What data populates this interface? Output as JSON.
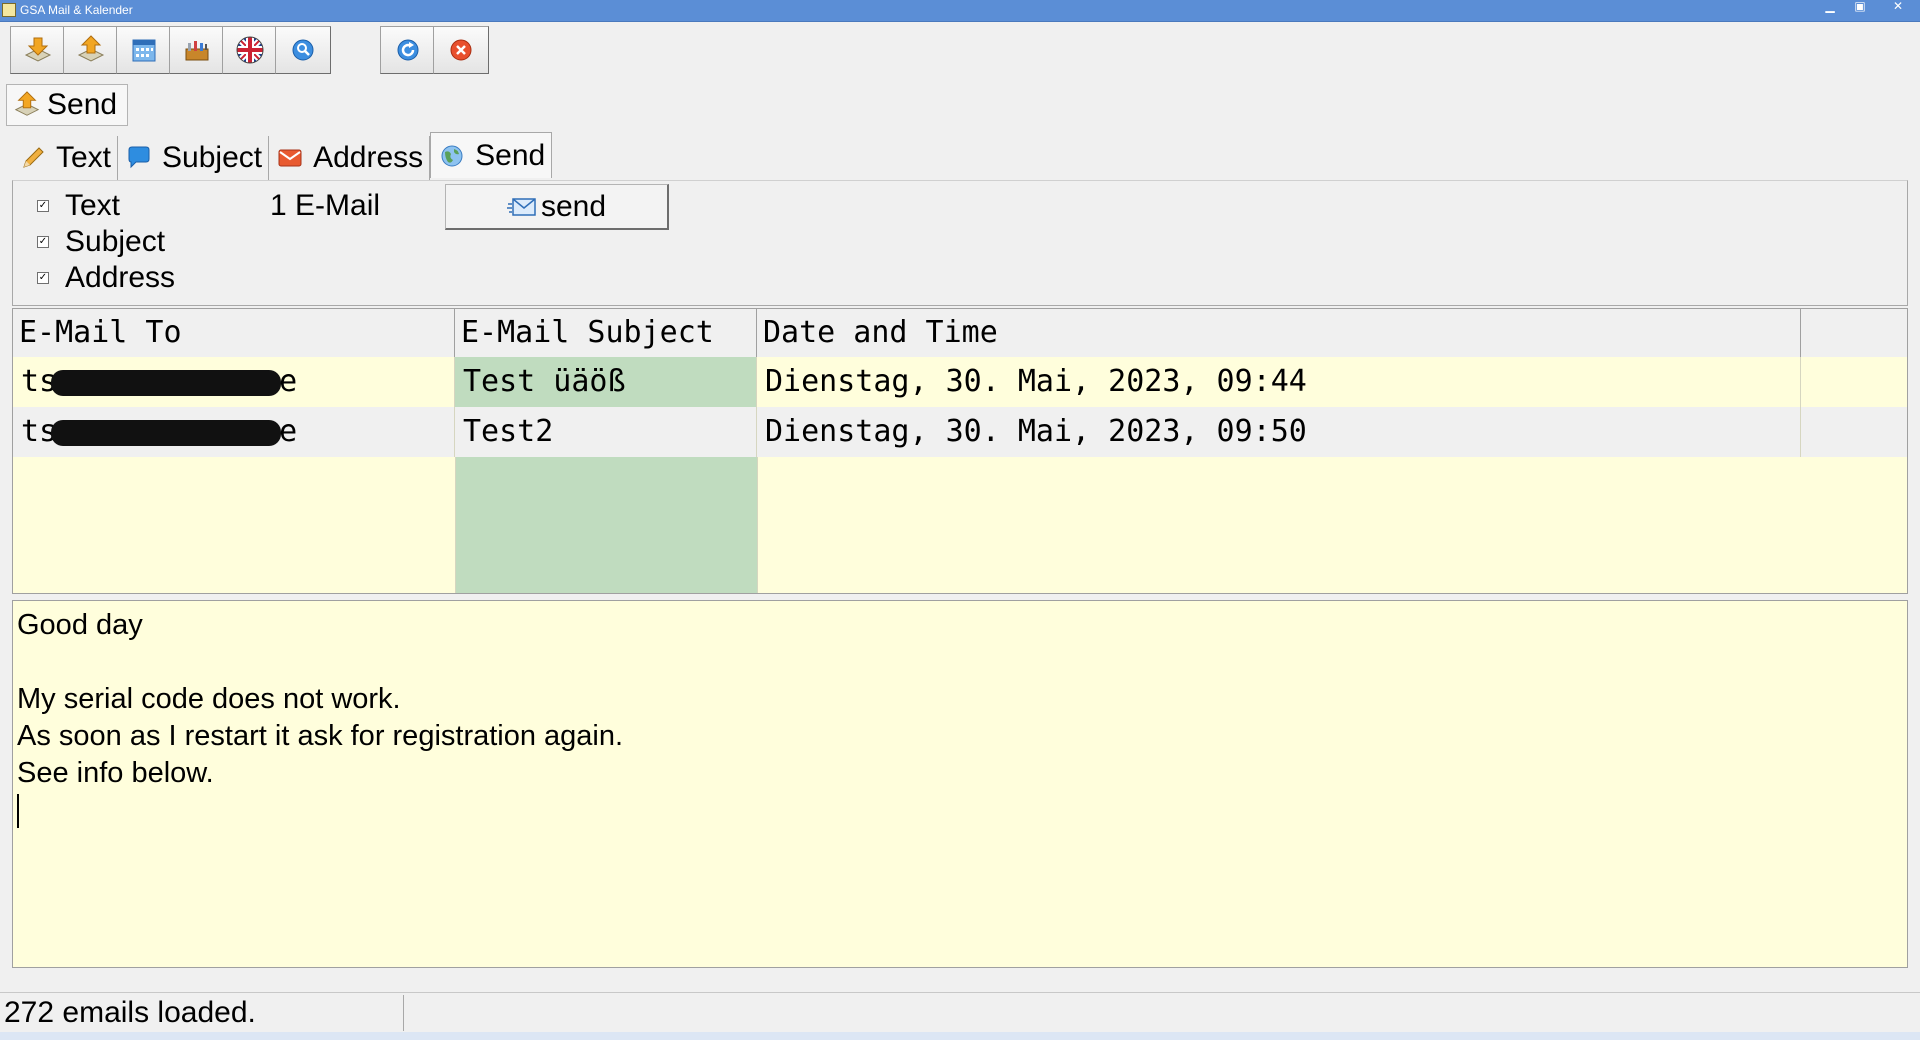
{
  "window": {
    "title": "GSA Mail & Kalender"
  },
  "toolbar": {
    "buttons": [
      {
        "icon": "download-icon"
      },
      {
        "icon": "upload-icon"
      },
      {
        "icon": "calendar-icon"
      },
      {
        "icon": "toolbox-icon"
      },
      {
        "icon": "uk-flag-icon"
      },
      {
        "icon": "search-icon"
      },
      {
        "icon": "refresh-icon"
      },
      {
        "icon": "close-icon"
      }
    ]
  },
  "header": {
    "send_label": "Send"
  },
  "tabs": [
    {
      "label": "Text",
      "icon": "pencil-icon"
    },
    {
      "label": "Subject",
      "icon": "speech-bubble-icon"
    },
    {
      "label": "Address",
      "icon": "envelope-icon"
    },
    {
      "label": "Send",
      "icon": "globe-icon",
      "active": true
    }
  ],
  "options": {
    "checkboxes": [
      {
        "label": "Text",
        "checked": true
      },
      {
        "label": "Subject",
        "checked": true
      },
      {
        "label": "Address",
        "checked": true
      }
    ],
    "count_label": "1 E-Mail",
    "send_button": "send"
  },
  "grid": {
    "columns": [
      "E-Mail To",
      "E-Mail Subject",
      "Date and Time"
    ],
    "rows": [
      {
        "to_prefix": "ts",
        "to_suffix": "e",
        "subject": "Test üäöß",
        "datetime": "Dienstag, 30. Mai, 2023, 09:44"
      },
      {
        "to_prefix": "ts",
        "to_suffix": "e",
        "subject": "Test2",
        "datetime": "Dienstag, 30. Mai, 2023, 09:50"
      }
    ]
  },
  "body": {
    "lines": [
      "Good day",
      "",
      "My serial code does not work.",
      "As soon as I restart it ask for registration again.",
      "See info below."
    ]
  },
  "status": {
    "text": "272 emails loaded."
  },
  "colors": {
    "titlebar": "#5b8ed6",
    "grid_bg": "#fffedc",
    "selected_column": "#c0dcbf",
    "alt_row": "#f0f0f0"
  }
}
